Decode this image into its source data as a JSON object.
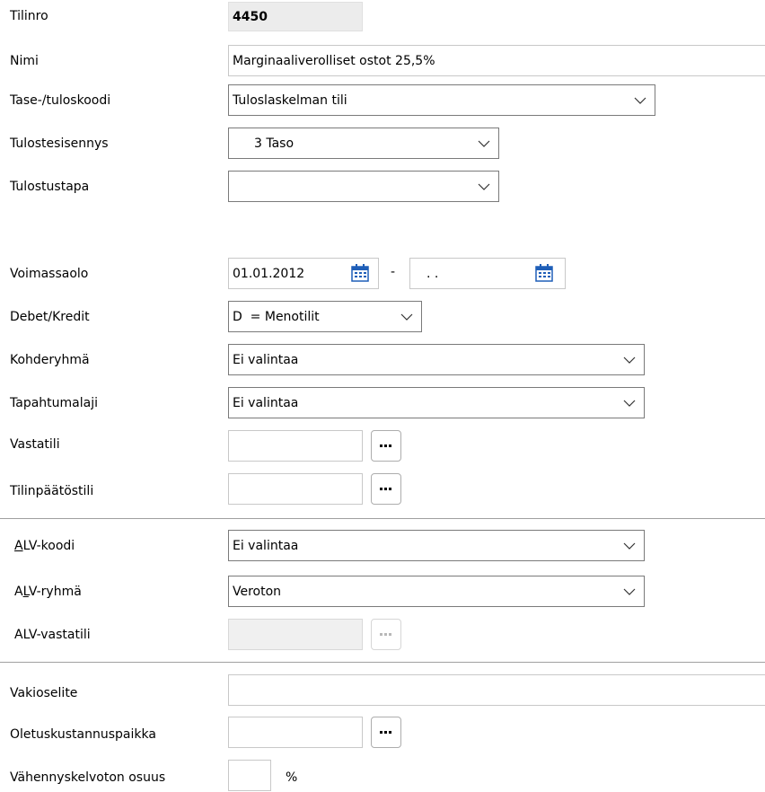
{
  "account": {
    "number_label": "Tilinro",
    "number_value": "4450",
    "name_label": "Nimi",
    "name_value": "Marginaaliverolliset ostot 25,5%",
    "balance_code_label": "Tase-/tuloskoodi",
    "balance_code_value": "Tuloslaskelman tili",
    "print_indent_label": "Tulostesisennys",
    "print_indent_value": "3 Taso",
    "print_method_label": "Tulostustapa",
    "print_method_value": ""
  },
  "validity": {
    "label": "Voimassaolo",
    "start": "01.01.2012",
    "separator": "-",
    "end": ". .",
    "debit_credit_label": "Debet/Kredit",
    "debit_credit_value": "D  = Menotilit",
    "target_group_label": "Kohderyhmä",
    "target_group_value": "Ei valintaa",
    "event_type_label": "Tapahtumalaji",
    "event_type_value": "Ei valintaa",
    "contra_label": "Vastatili",
    "contra_value": "",
    "closing_label": "Tilinpäätöstili",
    "closing_value": ""
  },
  "vat": {
    "code_label_key": "A",
    "code_label_rest": "LV-koodi",
    "code_value": "Ei valintaa",
    "group_label_pre": "A",
    "group_label_key": "L",
    "group_label_rest": "V-ryhmä",
    "group_value": "Veroton",
    "contra_label": "ALV-vastatili",
    "contra_value": ""
  },
  "misc": {
    "default_text_label": "Vakioselite",
    "default_text_value": "",
    "cost_center_label": "Oletuskustannuspaikka",
    "cost_center_value": "",
    "nondeductible_label": "Vähennyskelvoton osuus",
    "nondeductible_value": "",
    "percent_sign": "%"
  },
  "icons": {
    "dropdown": "chevron-down-icon",
    "browse": "ellipsis-icon",
    "calendar": "calendar-icon"
  }
}
